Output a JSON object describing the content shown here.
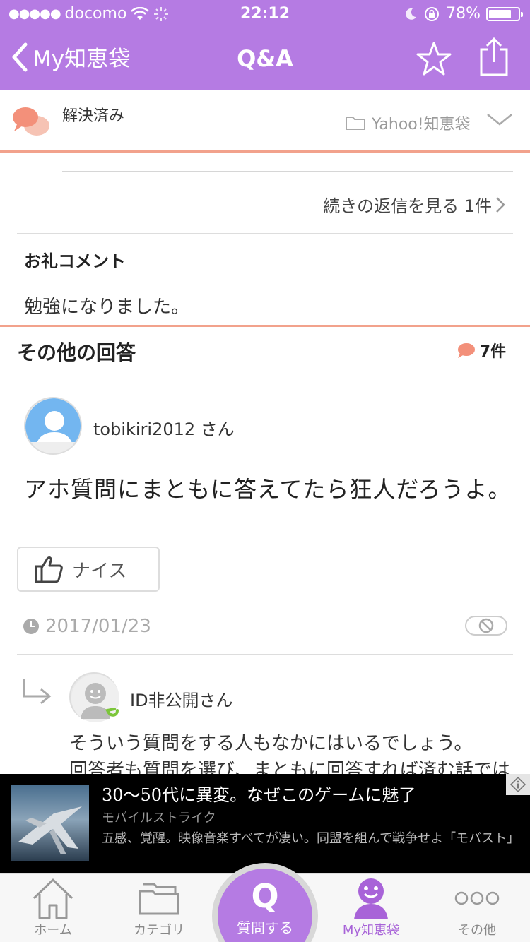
{
  "status_bar": {
    "carrier": "docomo",
    "time": "22:12",
    "battery": "78%",
    "battery_level": 0.78
  },
  "nav": {
    "back_label": "My知恵袋",
    "title": "Q&A"
  },
  "category_header": {
    "status": "解決済み",
    "category": "Yahoo!知恵袋"
  },
  "replies_link": "続きの返信を見る 1件",
  "thanks": {
    "heading": "お礼コメント",
    "body": "勉強になりました。"
  },
  "other_answers": {
    "heading": "その他の回答",
    "count": "7件",
    "answer": {
      "user": "tobikiri2012 さん",
      "text": "アホ質問にまともに答えてたら狂人だろうよ。",
      "nice_label": "ナイス",
      "date": "2017/01/23"
    },
    "reply": {
      "user": "ID非公開さん",
      "line1": "そういう質問をする人もなかにはいるでしょう。",
      "line2": "回答者も質問を選び、まともに回答すれば済む話では"
    }
  },
  "ad": {
    "title": "30〜50代に異変。なぜこのゲームに魅了",
    "source": "モバイルストライク",
    "description": "五感、覚醒。映像音楽すべてが凄い。同盟を組んで戦争せよ「モバスト」"
  },
  "tabbar": {
    "home": "ホーム",
    "category": "カテゴリ",
    "ask": "質問する",
    "ask_glyph": "Q",
    "my": "My知恵袋",
    "other": "その他"
  },
  "colors": {
    "accent": "#b57be3",
    "salmon": "#f2a28c",
    "active_tab": "#a863d8"
  }
}
